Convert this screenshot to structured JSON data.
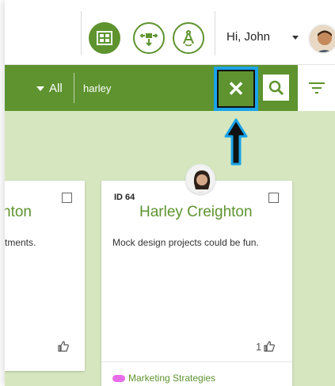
{
  "header": {
    "greeting": "Hi, John",
    "icons": [
      "board-icon",
      "move-arrows-icon",
      "compass-icon"
    ],
    "accent_color": "#5e932f"
  },
  "toolbar": {
    "filter_label": "All",
    "search_value": "harley",
    "clear_label": "✕"
  },
  "cards": [
    {
      "name_fragment": "nton",
      "desc_fragment": "rtments."
    },
    {
      "id": "ID 64",
      "name": "Harley Creighton",
      "description": "Mock design projects could be fun.",
      "likes": "1",
      "tag": "Marketing Strategies",
      "tag_color": "#e76ee6"
    }
  ],
  "board_color": "#d6e7c0",
  "highlight_color": "#1aa3e8"
}
